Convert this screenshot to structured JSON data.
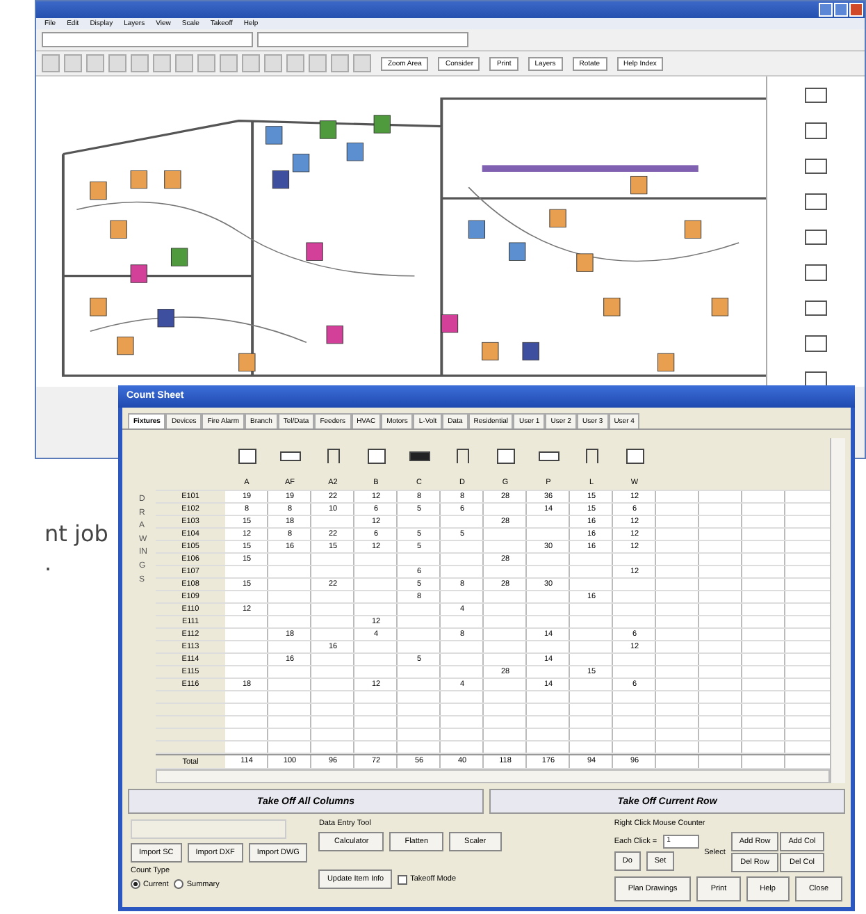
{
  "back_window": {
    "menu": [
      "File",
      "Edit",
      "Display",
      "Layers",
      "View",
      "Scale",
      "Takeoff",
      "Help"
    ],
    "toolbar_buttons": [
      "Zoom Area",
      "Consider",
      "Print",
      "Layers",
      "Rotate",
      "Help Index"
    ]
  },
  "brochure_text": [
    "nt job",
    "."
  ],
  "count_sheet": {
    "title": "Count Sheet",
    "tabs": [
      {
        "label": "Fixtures",
        "selected": true
      },
      {
        "label": "Devices",
        "selected": false
      },
      {
        "label": "Fire Alarm",
        "selected": false
      },
      {
        "label": "Branch",
        "selected": false
      },
      {
        "label": "Tel/Data",
        "selected": false
      },
      {
        "label": "Feeders",
        "selected": false
      },
      {
        "label": "HVAC",
        "selected": false
      },
      {
        "label": "Motors",
        "selected": false
      },
      {
        "label": "L-Volt",
        "selected": false
      },
      {
        "label": "Data",
        "selected": false
      },
      {
        "label": "Residential",
        "selected": false
      },
      {
        "label": "User 1",
        "selected": false
      },
      {
        "label": "User 2",
        "selected": false
      },
      {
        "label": "User 3",
        "selected": false
      },
      {
        "label": "User 4",
        "selected": false
      }
    ],
    "side_label": "DRAWINGS",
    "columns": [
      "A",
      "AF",
      "A2",
      "B",
      "C",
      "D",
      "G",
      "P",
      "L",
      "W"
    ],
    "rows": [
      {
        "label": "E101",
        "cells": [
          "19",
          "19",
          "22",
          "12",
          "8",
          "8",
          "28",
          "36",
          "15",
          "12"
        ]
      },
      {
        "label": "E102",
        "cells": [
          "8",
          "8",
          "10",
          "6",
          "5",
          "6",
          "",
          "14",
          "15",
          "6"
        ]
      },
      {
        "label": "E103",
        "cells": [
          "15",
          "18",
          "",
          "12",
          "",
          "",
          "28",
          "",
          "16",
          "12"
        ]
      },
      {
        "label": "E104",
        "cells": [
          "12",
          "8",
          "22",
          "6",
          "5",
          "5",
          "",
          "",
          "16",
          "12"
        ]
      },
      {
        "label": "E105",
        "cells": [
          "15",
          "16",
          "15",
          "12",
          "5",
          "",
          "",
          "30",
          "16",
          "12"
        ]
      },
      {
        "label": "E106",
        "cells": [
          "15",
          "",
          "",
          "",
          "",
          "",
          "28",
          "",
          "",
          ""
        ]
      },
      {
        "label": "E107",
        "cells": [
          "",
          "",
          "",
          "",
          "6",
          "",
          "",
          "",
          "",
          "12"
        ]
      },
      {
        "label": "E108",
        "cells": [
          "15",
          "",
          "22",
          "",
          "5",
          "8",
          "28",
          "30",
          "",
          ""
        ]
      },
      {
        "label": "E109",
        "cells": [
          "",
          "",
          "",
          "",
          "8",
          "",
          "",
          "",
          "16",
          ""
        ]
      },
      {
        "label": "E110",
        "cells": [
          "12",
          "",
          "",
          "",
          "",
          "4",
          "",
          "",
          "",
          ""
        ]
      },
      {
        "label": "E111",
        "cells": [
          "",
          "",
          "",
          "12",
          "",
          "",
          "",
          "",
          "",
          ""
        ]
      },
      {
        "label": "E112",
        "cells": [
          "",
          "18",
          "",
          "4",
          "",
          "8",
          "",
          "14",
          "",
          "6"
        ]
      },
      {
        "label": "E113",
        "cells": [
          "",
          "",
          "16",
          "",
          "",
          "",
          "",
          "",
          "",
          "12"
        ]
      },
      {
        "label": "E114",
        "cells": [
          "",
          "16",
          "",
          "",
          "5",
          "",
          "",
          "14",
          "",
          ""
        ]
      },
      {
        "label": "E115",
        "cells": [
          "",
          "",
          "",
          "",
          "",
          "",
          "28",
          "",
          "15",
          ""
        ]
      },
      {
        "label": "E116",
        "cells": [
          "18",
          "",
          "",
          "12",
          "",
          "4",
          "",
          "14",
          "",
          "6"
        ]
      }
    ],
    "total_label": "Total",
    "totals": [
      "114",
      "100",
      "96",
      "72",
      "56",
      "40",
      "118",
      "176",
      "94",
      "96"
    ],
    "takeoff_buttons": [
      "Take Off All Columns",
      "Take Off Current Row"
    ],
    "import_buttons": [
      "Import SC",
      "Import DXF",
      "Import DWG"
    ],
    "count_type": {
      "label": "Count Type",
      "options": [
        {
          "label": "Current",
          "selected": true
        },
        {
          "label": "Summary",
          "selected": false
        }
      ]
    },
    "data_entry": {
      "label": "Data Entry Tool",
      "buttons": [
        "Calculator",
        "Flatten",
        "Scaler"
      ]
    },
    "update_button": "Update Item Info",
    "takeoff_mode": {
      "label": "Takeoff Mode",
      "checked": false
    },
    "mouse_counter": {
      "label": "Right Click Mouse Counter",
      "each_click": "Each Click =",
      "value": "1",
      "select_label": "Select",
      "set_button": "Set",
      "do_button": "Do",
      "row_col_buttons": [
        "Add Row",
        "Add Col",
        "Del Row",
        "Del Col"
      ]
    },
    "footer_buttons": [
      "Plan Drawings",
      "Print",
      "Help",
      "Close"
    ]
  }
}
